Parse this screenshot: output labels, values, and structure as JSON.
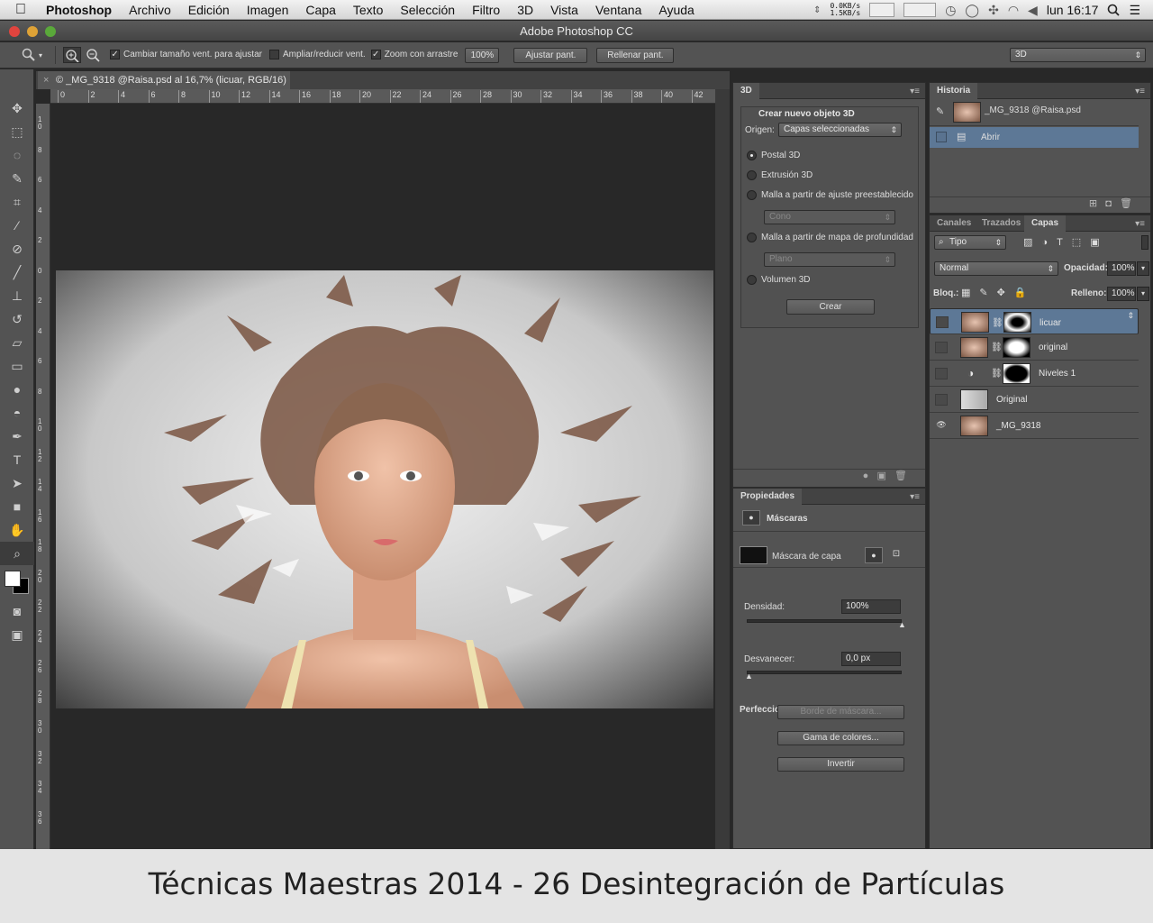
{
  "menubar": {
    "app": "Photoshop",
    "items": [
      "Archivo",
      "Edición",
      "Imagen",
      "Capa",
      "Texto",
      "Selección",
      "Filtro",
      "3D",
      "Vista",
      "Ventana",
      "Ayuda"
    ],
    "net_up": "0.0KB/s",
    "net_down": "1.5KB/s",
    "clock": "lun 16:17"
  },
  "window": {
    "title": "Adobe Photoshop CC"
  },
  "options": {
    "resize_windows": "Cambiar tamaño vent. para ajustar",
    "zoom_all": "Ampliar/reducir vent.",
    "scrubby_zoom": "Zoom con arrastre",
    "zoom_value": "100%",
    "fit_screen": "Ajustar pant.",
    "fill_screen": "Rellenar pant.",
    "workspace": "3D"
  },
  "document": {
    "tab_title": "© _MG_9318 @Raisa.psd al 16,7% (licuar, RGB/16)",
    "ruler_h": [
      "0",
      "2",
      "4",
      "6",
      "8",
      "10",
      "12",
      "14",
      "16",
      "18",
      "20",
      "22",
      "24",
      "26",
      "28",
      "30",
      "32",
      "34",
      "36",
      "38",
      "40",
      "42"
    ],
    "ruler_v": [
      "1 0",
      "8",
      "6",
      "4",
      "2",
      "0",
      "2",
      "4",
      "6",
      "8",
      "1 0",
      "1 2",
      "1 4",
      "1 6",
      "1 8",
      "2 0",
      "2 2",
      "2 4",
      "2 6",
      "2 8",
      "3 0",
      "3 2",
      "3 4",
      "3 6"
    ]
  },
  "panel3d": {
    "tab": "3D",
    "group_title": "Crear nuevo objeto 3D",
    "source_label": "Origen:",
    "source_value": "Capas seleccionadas",
    "opt_postal": "Postal 3D",
    "opt_extrusion": "Extrusión 3D",
    "opt_mesh_preset": "Malla a partir de ajuste preestablecido",
    "preset_value": "Cono",
    "opt_mesh_depth": "Malla a partir de mapa de profundidad",
    "depth_value": "Plano",
    "opt_volume": "Volumen 3D",
    "create": "Crear"
  },
  "properties": {
    "tab": "Propiedades",
    "section": "Máscaras",
    "mask_label": "Máscara de capa",
    "density_label": "Densidad:",
    "density_value": "100%",
    "density_level": 1.0,
    "feather_label": "Desvanecer:",
    "feather_value": "0,0 px",
    "feather_level": 0.0,
    "refine_label": "Perfeccio",
    "mask_edge": "Borde de máscara...",
    "color_range": "Gama de colores...",
    "invert": "Invertir"
  },
  "history": {
    "tab": "Historia",
    "snapshot": "_MG_9318 @Raisa.psd",
    "step_open": "Abrir"
  },
  "layers": {
    "tabs": [
      "Canales",
      "Trazados",
      "Capas"
    ],
    "filter": "Tipo",
    "blend": "Normal",
    "opacity_label": "Opacidad:",
    "opacity": "100%",
    "lock_label": "Bloq.:",
    "fill_label": "Relleno:",
    "fill": "100%",
    "rows": [
      {
        "name": "licuar",
        "visible": false,
        "selected": true
      },
      {
        "name": "original",
        "visible": false,
        "selected": false
      },
      {
        "name": "Niveles 1",
        "visible": false,
        "selected": false
      },
      {
        "name": "Original",
        "visible": false,
        "selected": false
      },
      {
        "name": "_MG_9318",
        "visible": true,
        "selected": false
      }
    ]
  },
  "caption": "Técnicas Maestras 2014 - 26 Desintegración de Partículas",
  "colors": {
    "selection": "#5d7896",
    "panel": "#535353",
    "canvas_bg": "#282828"
  },
  "icons": [
    "apple-icon",
    "search-icon",
    "zoom-in-icon",
    "zoom-out-icon",
    "eye-icon",
    "link-icon",
    "mask-icon",
    "trash-icon",
    "camera-icon",
    "new-layer-icon"
  ]
}
